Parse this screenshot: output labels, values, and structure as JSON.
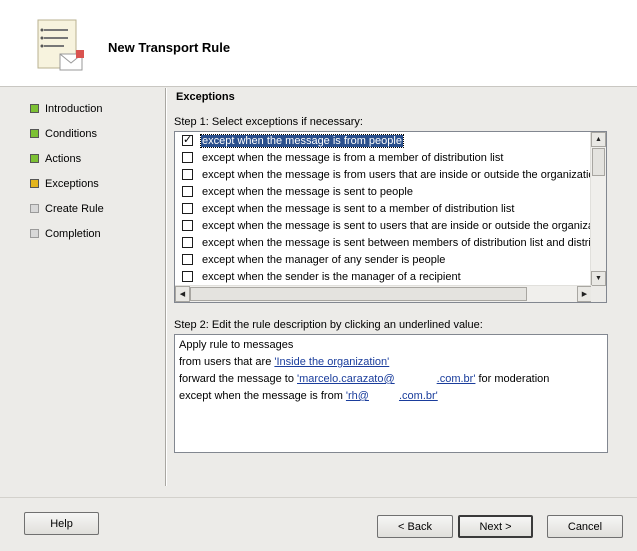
{
  "wizard": {
    "title": "New Transport Rule"
  },
  "nav": {
    "items": [
      {
        "label": "Introduction",
        "state": "done",
        "color": "#7cc134"
      },
      {
        "label": "Conditions",
        "state": "done",
        "color": "#7cc134"
      },
      {
        "label": "Actions",
        "state": "done",
        "color": "#7cc134"
      },
      {
        "label": "Exceptions",
        "state": "current",
        "color": "#e3b51e"
      },
      {
        "label": "Create Rule",
        "state": "pending",
        "color": "#d8d8d8"
      },
      {
        "label": "Completion",
        "state": "pending",
        "color": "#d8d8d8"
      }
    ]
  },
  "page": {
    "section_title": "Exceptions",
    "step1_label": "Step 1: Select exceptions if necessary:",
    "exceptions": [
      {
        "label": "except when the message is from people",
        "checked": true,
        "selected": true
      },
      {
        "label": "except when the message is from a member of distribution list",
        "checked": false,
        "selected": false
      },
      {
        "label": "except when the message is from users that are inside or outside the organization",
        "checked": false,
        "selected": false
      },
      {
        "label": "except when the message is sent to people",
        "checked": false,
        "selected": false
      },
      {
        "label": "except when the message is sent to a member of distribution list",
        "checked": false,
        "selected": false
      },
      {
        "label": "except when the message is sent to users that are inside or outside the organization",
        "checked": false,
        "selected": false
      },
      {
        "label": "except when the message is sent between members of distribution list and distribution list",
        "checked": false,
        "selected": false
      },
      {
        "label": "except when the manager of any sender is people",
        "checked": false,
        "selected": false
      },
      {
        "label": "except when the sender is the manager of a recipient",
        "checked": false,
        "selected": false
      }
    ],
    "step2_label": "Step 2: Edit the rule description by clicking an underlined value:",
    "description": {
      "line1": "Apply rule to messages",
      "line2_prefix": "from users that are ",
      "line2_link": "'Inside the organization'",
      "line3_prefix": "forward  the  message  to  ",
      "line3_link_a": "'marcelo.carazato@",
      "line3_link_b": ".com.br'",
      "line3_suffix": "  for  moderation",
      "line4_prefix": "except  when  the  message  is  from  ",
      "line4_link_a": "'rh@",
      "line4_link_b": ".com.br'"
    }
  },
  "buttons": {
    "help": "Help",
    "back": "< Back",
    "next": "Next >",
    "cancel": "Cancel"
  }
}
